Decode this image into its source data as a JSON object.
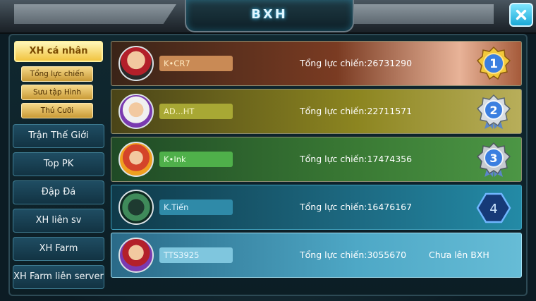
{
  "header": {
    "title": "BXH"
  },
  "sidebar": {
    "personal_tab": "XH cá nhân",
    "sub_tabs": [
      "Tổng lực chiến",
      "Sưu tập Hình",
      "Thú Cưỡi"
    ],
    "main_tabs": [
      "Trận Thế Giới",
      "Top PK",
      "Đập Đá",
      "XH liên sv",
      "XH Farm",
      "XH Farm liên server"
    ]
  },
  "rankings": [
    {
      "name": "K•CR7",
      "power": "Tổng lực chiến:26731290",
      "rank": "1"
    },
    {
      "name": "AD...HT",
      "power": "Tổng lực chiến:22711571",
      "rank": "2"
    },
    {
      "name": "K•Ink",
      "power": "Tổng lực chiến:17474356",
      "rank": "3"
    },
    {
      "name": "K.Tiến",
      "power": "Tổng lực chiến:16476167",
      "rank": "4"
    }
  ],
  "self_row": {
    "name": "TTS3925",
    "power": "Tổng lực chiến:3055670",
    "status": "Chưa lên BXH"
  },
  "colors": {
    "accent": "#3cc8ff",
    "gold": "#f1c440",
    "name_r1": "#c98a55",
    "name_r2": "#a8a834",
    "name_r3": "#4fb04a"
  }
}
